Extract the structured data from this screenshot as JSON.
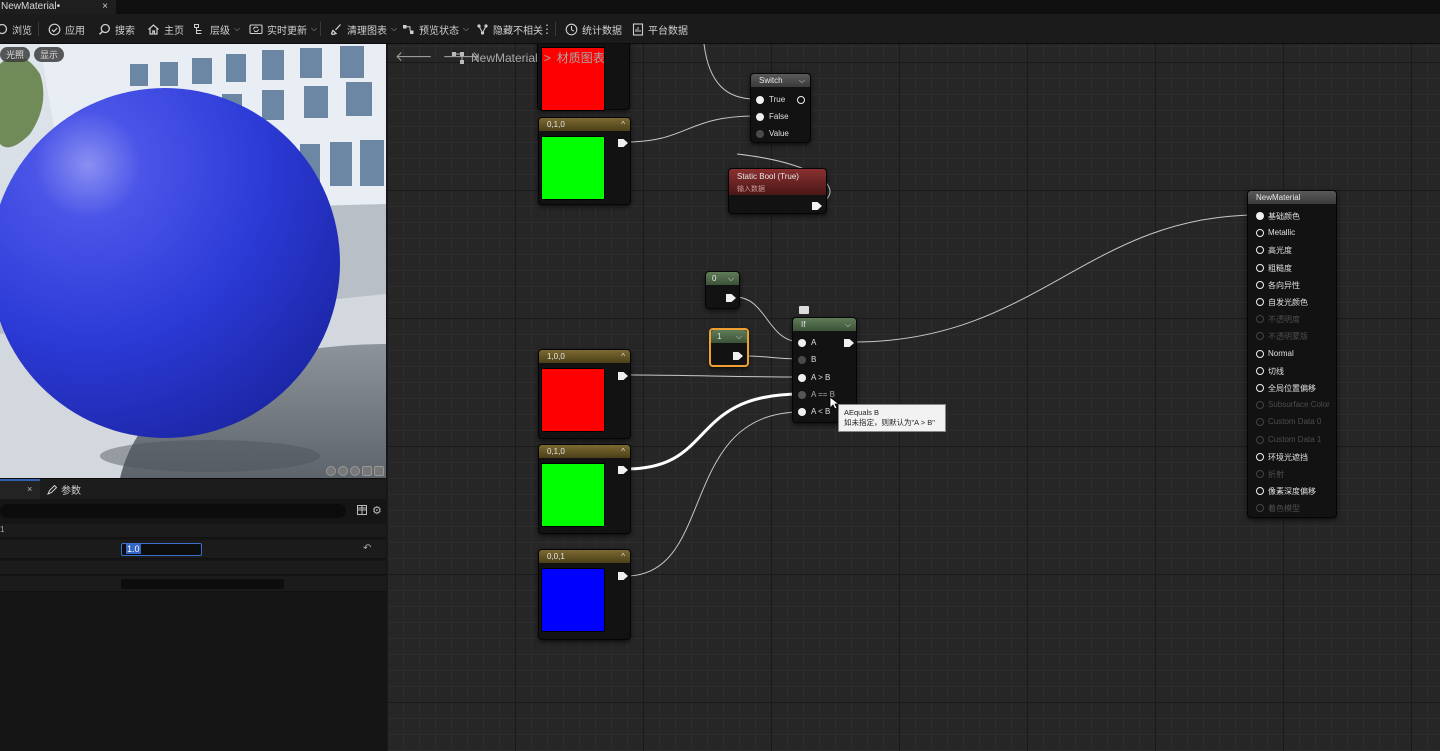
{
  "window": {
    "tab_title": "NewMaterial•",
    "tab_close": "×"
  },
  "toolbar": {
    "items": [
      {
        "label": "浏览",
        "icon": "browse-icon"
      },
      {
        "label": "应用",
        "icon": "apply-icon"
      },
      {
        "label": "搜索",
        "icon": "search-icon"
      },
      {
        "label": "主页",
        "icon": "home-icon"
      },
      {
        "label": "层级",
        "icon": "hierarchy-icon",
        "dropdown": true
      },
      {
        "label": "实时更新",
        "icon": "live-update-icon",
        "dropdown": true
      },
      {
        "label": "清理图表",
        "icon": "clean-graph-icon",
        "dropdown": true
      },
      {
        "label": "预览状态",
        "icon": "preview-state-icon",
        "dropdown": true
      },
      {
        "label": "隐藏不相关",
        "icon": "hide-unrelated-icon"
      },
      {
        "label": "统计数据",
        "icon": "stats-icon"
      },
      {
        "label": "平台数据",
        "icon": "platform-stats-icon"
      }
    ]
  },
  "viewport": {
    "chip_lit": "光照",
    "chip_show": "显示"
  },
  "details": {
    "tab_close": "×",
    "params_tab": "参数",
    "value": "1.0",
    "row_mark": "1"
  },
  "graph": {
    "breadcrumb_root": "NewMaterial",
    "breadcrumb_sep": ">",
    "breadcrumb_page": "材质图表",
    "nodes": {
      "const_red_top": {
        "title": "",
        "color": "#ff0000"
      },
      "const_green_top": {
        "title": "0,1,0",
        "color": "#00ff00"
      },
      "switch": {
        "title": "Switch",
        "pins": [
          "True",
          "False",
          "Value"
        ]
      },
      "static_bool": {
        "title": "Static Bool (True)",
        "subtitle": "输入数据"
      },
      "const_0": {
        "title": "0"
      },
      "const_1": {
        "title": "1"
      },
      "if_node": {
        "title": "If",
        "pins": [
          "A",
          "B",
          "A > B",
          "A == B",
          "A < B"
        ]
      },
      "const_red": {
        "title": "1,0,0",
        "color": "#ff0000"
      },
      "const_green": {
        "title": "0,1,0",
        "color": "#00ff00"
      },
      "const_blue": {
        "title": "0,0,1",
        "color": "#0000ff"
      },
      "result": {
        "title": "NewMaterial",
        "pins": [
          {
            "label": "基础颜色",
            "enabled": true,
            "filled": true
          },
          {
            "label": "Metallic",
            "enabled": true
          },
          {
            "label": "高光度",
            "enabled": true
          },
          {
            "label": "粗糙度",
            "enabled": true
          },
          {
            "label": "各向异性",
            "enabled": true
          },
          {
            "label": "自发光颜色",
            "enabled": true
          },
          {
            "label": "不透明度",
            "enabled": false
          },
          {
            "label": "不透明蒙版",
            "enabled": false
          },
          {
            "label": "Normal",
            "enabled": true
          },
          {
            "label": "切线",
            "enabled": true
          },
          {
            "label": "全局位置偏移",
            "enabled": true
          },
          {
            "label": "Subsurface Color",
            "enabled": false
          },
          {
            "label": "Custom Data 0",
            "enabled": false
          },
          {
            "label": "Custom Data 1",
            "enabled": false
          },
          {
            "label": "环境光遮挡",
            "enabled": true
          },
          {
            "label": "折射",
            "enabled": false
          },
          {
            "label": "像素深度偏移",
            "enabled": true
          },
          {
            "label": "着色模型",
            "enabled": false
          }
        ]
      }
    },
    "tooltip": {
      "line1": "AEquals B",
      "line2": "如未指定，则默认为\"A > B\""
    }
  }
}
